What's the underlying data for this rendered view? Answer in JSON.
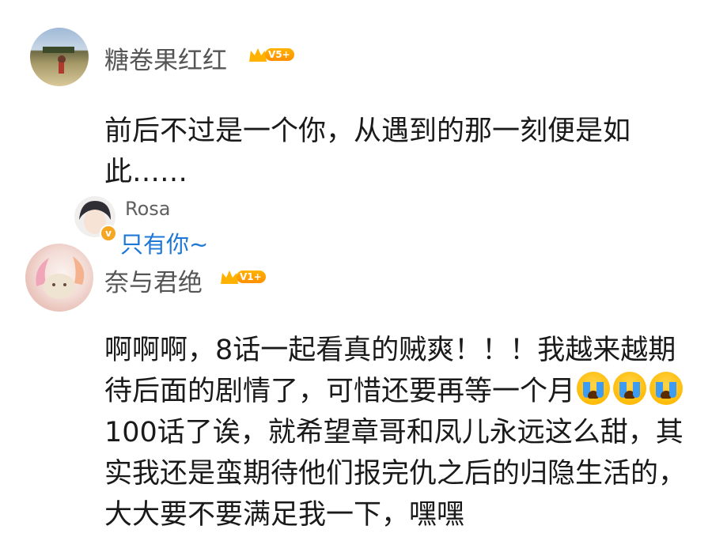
{
  "comments": [
    {
      "username": "糖卷果红红",
      "level": "V5+",
      "text": "前后不过是一个你，从遇到的那一刻便是如此……",
      "reply": {
        "username": "Rosa",
        "text": "只有你~"
      }
    },
    {
      "username": "奈与君绝",
      "level": "V1+",
      "text_parts": [
        "啊啊啊，8话一起看真的贼爽！！！我越来越期待后面的剧情了，可惜还要再等一个月",
        "100话了诶，就希望章哥和凤儿永远这么甜，其实我还是蛮期待他们报完仇之后的归隐生活的，大大要不要满足我一下，嘿嘿"
      ],
      "emoji": "loudly-crying-face"
    }
  ],
  "colors": {
    "username": "#555555",
    "reply_text": "#1e78d6",
    "badge": "#ff9f00"
  }
}
